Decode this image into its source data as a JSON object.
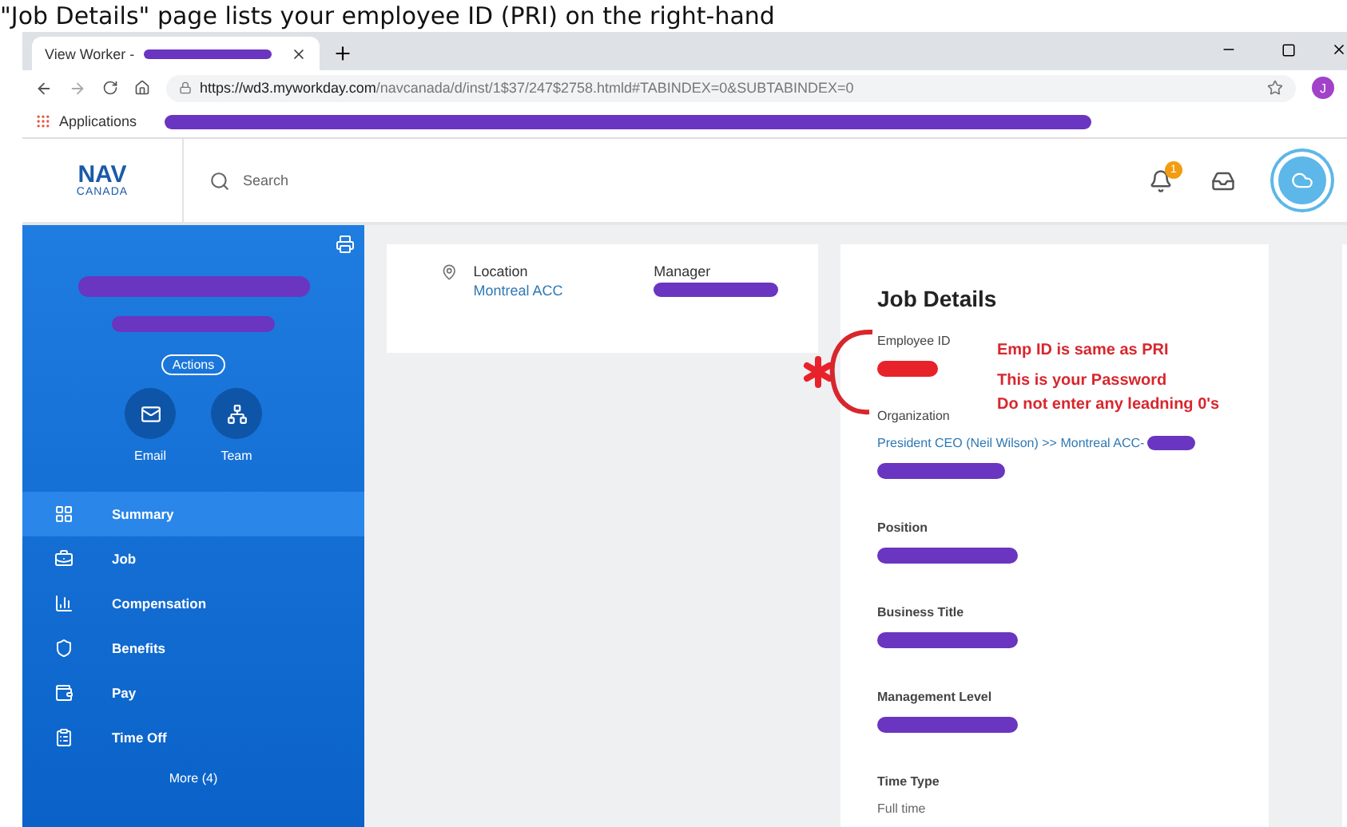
{
  "caption": "\"Job Details\" page lists your employee ID (PRI) on the right-hand",
  "browser": {
    "tab_title": "View Worker -",
    "url_host": "https://wd3.myworkday.com",
    "url_path": "/navcanada/d/inst/1$37/247$2758.htmld#TABINDEX=0&SUBTABINDEX=0",
    "profile_initial": "J",
    "bookmark": "Applications"
  },
  "header": {
    "logo_top": "NAV",
    "logo_bottom": "CANADA",
    "search_placeholder": "Search",
    "notification_count": "1"
  },
  "sidebar": {
    "actions": "Actions",
    "quick_actions": [
      {
        "label": "Email"
      },
      {
        "label": "Team"
      }
    ],
    "items": [
      {
        "label": "Summary",
        "selected": true
      },
      {
        "label": "Job",
        "selected": false
      },
      {
        "label": "Compensation",
        "selected": false
      },
      {
        "label": "Benefits",
        "selected": false
      },
      {
        "label": "Pay",
        "selected": false
      },
      {
        "label": "Time Off",
        "selected": false
      }
    ],
    "more": "More (4)"
  },
  "location_card": {
    "location_label": "Location",
    "location_value": "Montreal ACC",
    "manager_label": "Manager"
  },
  "job_details": {
    "title": "Job Details",
    "notes": [
      "Emp ID is same as PRI",
      "This is your Password",
      "Do not enter any leadning 0's"
    ],
    "fields": [
      {
        "label": "Employee ID",
        "redacted": true,
        "color": "#e8222a"
      },
      {
        "label": "Organization",
        "value": "President CEO (Neil Wilson) >> Montreal ACC-",
        "redacted": true,
        "color": "#6a35c0"
      },
      {
        "label": "Position",
        "redacted": true,
        "color": "#6a35c0"
      },
      {
        "label": "Business Title",
        "redacted": true,
        "color": "#6a35c0"
      },
      {
        "label": "Management Level",
        "redacted": true,
        "color": "#6a35c0"
      },
      {
        "label": "Time Type",
        "value": "Full time",
        "redacted": false
      }
    ]
  }
}
